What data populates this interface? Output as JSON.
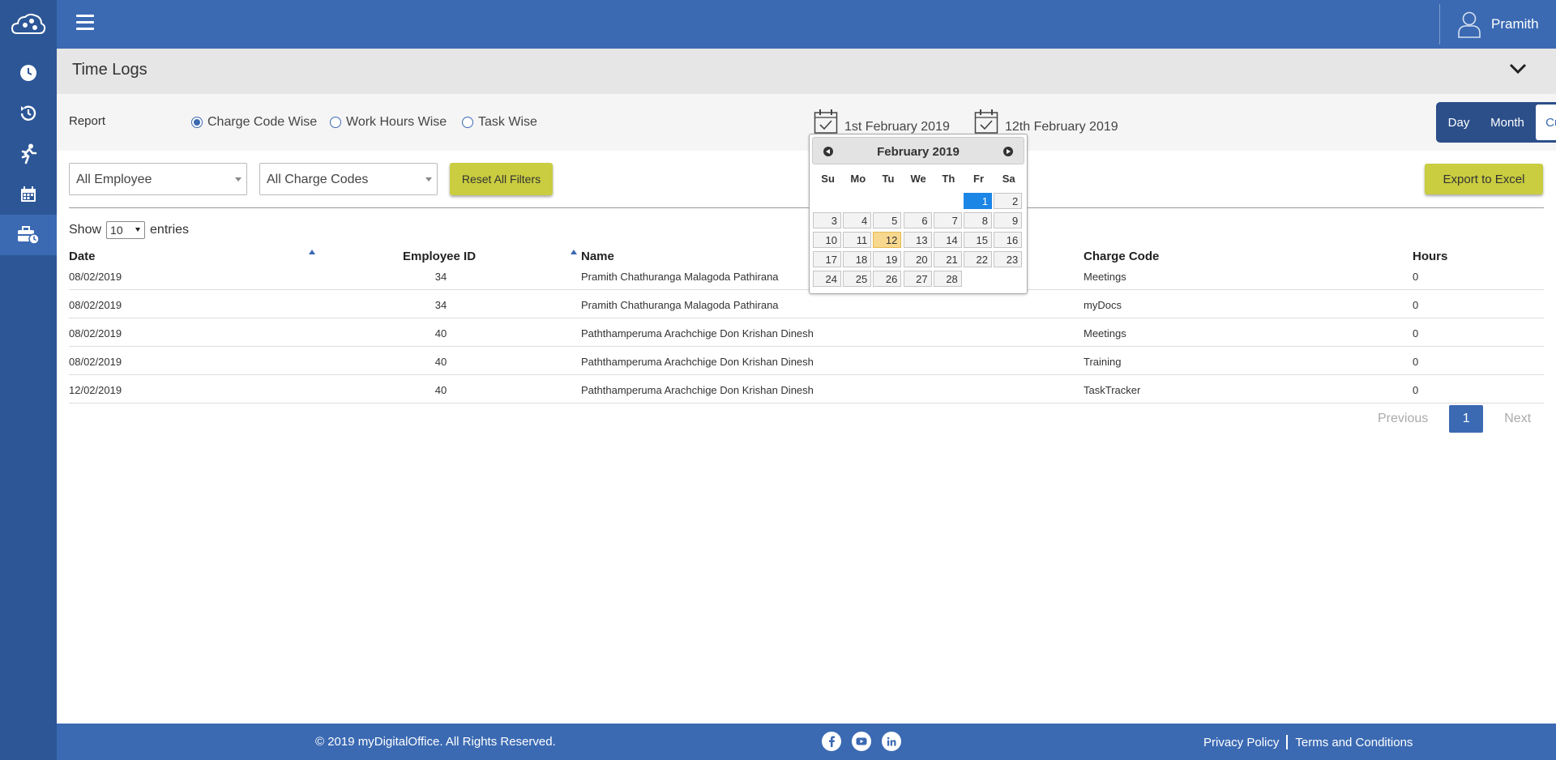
{
  "header": {
    "user_name": "Pramith"
  },
  "sidebar": {
    "items": [
      {
        "icon": "clock-icon"
      },
      {
        "icon": "history-icon"
      },
      {
        "icon": "running-man-icon"
      },
      {
        "icon": "calendar-icon"
      },
      {
        "icon": "briefcase-clock-icon",
        "active": true
      }
    ]
  },
  "section": {
    "title": "Time Logs"
  },
  "report": {
    "label": "Report",
    "options": [
      "Charge Code Wise",
      "Work Hours Wise",
      "Task Wise"
    ],
    "selected": "Charge Code Wise",
    "date_from": "1st February 2019",
    "date_to": "12th February 2019",
    "range_modes": [
      "Day",
      "Month",
      "Custom"
    ],
    "range_selected": "Custom"
  },
  "filters": {
    "employee": "All Employee",
    "charge_codes": "All Charge Codes",
    "reset_label": "Reset All Filters",
    "export_label": "Export to Excel"
  },
  "entries": {
    "show_label": "Show",
    "value": "10",
    "suffix": "entries"
  },
  "table": {
    "headers": [
      "Date",
      "Employee ID",
      "Name",
      "Charge Code",
      "Hours"
    ],
    "rows": [
      [
        "08/02/2019",
        "34",
        "Pramith Chathuranga Malagoda Pathirana",
        "Meetings",
        "0"
      ],
      [
        "08/02/2019",
        "34",
        "Pramith Chathuranga Malagoda Pathirana",
        "myDocs",
        "0"
      ],
      [
        "08/02/2019",
        "40",
        "Paththamperuma Arachchige Don Krishan Dinesh",
        "Meetings",
        "0"
      ],
      [
        "08/02/2019",
        "40",
        "Paththamperuma Arachchige Don Krishan Dinesh",
        "Training",
        "0"
      ],
      [
        "12/02/2019",
        "40",
        "Paththamperuma Arachchige Don Krishan Dinesh",
        "TaskTracker",
        "0"
      ]
    ]
  },
  "pagination": {
    "previous": "Previous",
    "current": "1",
    "next": "Next"
  },
  "calendar": {
    "title": "February 2019",
    "weekdays": [
      "Su",
      "Mo",
      "Tu",
      "We",
      "Th",
      "Fr",
      "Sa"
    ],
    "first_weekday_index": 5,
    "days_in_month": 28,
    "selected_day": 1,
    "today_day": 12
  },
  "footer": {
    "copyright": "© 2019 myDigitalOffice. All Rights Reserved.",
    "social": [
      "facebook-icon",
      "youtube-icon",
      "linkedin-icon"
    ],
    "privacy": "Privacy Policy",
    "terms": "Terms and Conditions"
  },
  "colors": {
    "primary": "#3b6ab3",
    "sidebar": "#2c5696",
    "accent_olive": "#c9cd3f",
    "calendar_selected": "#1c86e6",
    "calendar_today": "#f8d88f"
  }
}
